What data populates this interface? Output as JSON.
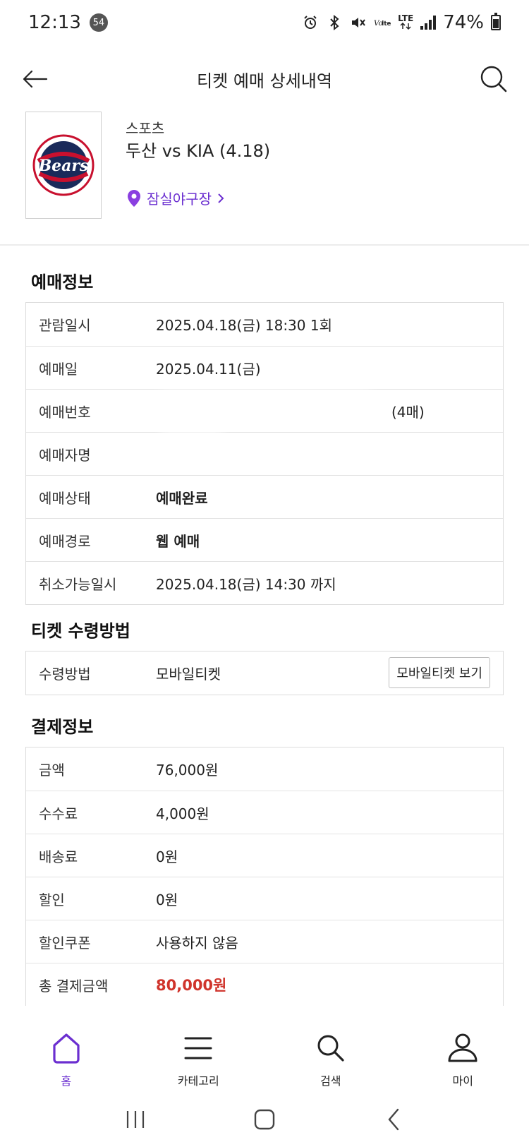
{
  "status_bar": {
    "time": "12:13",
    "notification_count": "54",
    "lte_label": "LTE",
    "battery": "74%"
  },
  "header": {
    "title": "티켓 예매 상세내역"
  },
  "event": {
    "category": "스포츠",
    "name": "두산 vs KIA (4.18)",
    "venue": "잠실야구장",
    "logo_text": "Bears"
  },
  "booking": {
    "title": "예매정보",
    "rows": [
      {
        "label": "관람일시",
        "value": "2025.04.18(금) 18:30 1회"
      },
      {
        "label": "예매일",
        "value": "2025.04.11(금)"
      },
      {
        "label": "예매번호",
        "value": "(4매)"
      },
      {
        "label": "예매자명",
        "value": ""
      },
      {
        "label": "예매상태",
        "value": "예매완료"
      },
      {
        "label": "예매경로",
        "value": "웹 예매"
      },
      {
        "label": "취소가능일시",
        "value": "2025.04.18(금) 14:30 까지"
      }
    ]
  },
  "receipt": {
    "title": "티켓 수령방법",
    "label": "수령방법",
    "value": "모바일티켓",
    "button": "모바일티켓 보기"
  },
  "payment": {
    "title": "결제정보",
    "rows": [
      {
        "label": "금액",
        "value": "76,000원"
      },
      {
        "label": "수수료",
        "value": "4,000원"
      },
      {
        "label": "배송료",
        "value": "0원"
      },
      {
        "label": "할인",
        "value": "0원"
      },
      {
        "label": "할인쿠폰",
        "value": "사용하지 않음"
      },
      {
        "label": "총 결제금액",
        "value": "80,000원"
      }
    ]
  },
  "bottom_nav": {
    "items": [
      {
        "label": "홈",
        "icon": "home-icon",
        "active": true
      },
      {
        "label": "카테고리",
        "icon": "menu-icon",
        "active": false
      },
      {
        "label": "검색",
        "icon": "search-icon",
        "active": false
      },
      {
        "label": "마이",
        "icon": "user-icon",
        "active": false
      }
    ]
  },
  "colors": {
    "accent": "#6b2fd0",
    "total": "#d0342c",
    "border": "#dcdcdc"
  }
}
